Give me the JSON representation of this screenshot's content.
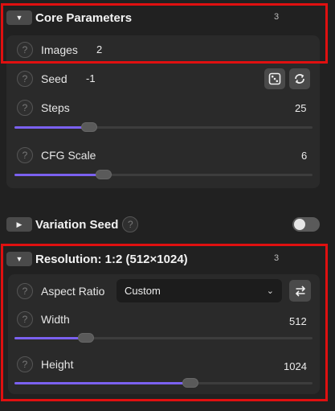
{
  "core": {
    "title": "Core Parameters",
    "count": "3",
    "images_label": "Images",
    "images_value": "2",
    "seed_label": "Seed",
    "seed_value": "-1",
    "steps_label": "Steps",
    "steps_value": "25",
    "steps_fraction": 0.25,
    "cfg_label": "CFG Scale",
    "cfg_value": "6",
    "cfg_fraction": 0.3
  },
  "variation": {
    "title": "Variation Seed",
    "enabled": false
  },
  "resolution": {
    "title": "Resolution: 1:2 (512×1024)",
    "count": "3",
    "aspect_label": "Aspect Ratio",
    "aspect_value": "Custom",
    "width_label": "Width",
    "width_value": "512",
    "width_fraction": 0.24,
    "height_label": "Height",
    "height_value": "1024",
    "height_fraction": 0.59
  },
  "help_glyph": "?",
  "icons": {
    "expanded": "chevron-down-icon",
    "collapsed": "chevron-right-icon",
    "dice": "dice-icon",
    "recycle": "recycle-icon",
    "swap": "swap-icon"
  },
  "colors": {
    "accent": "#7b61f0",
    "highlight": "#e01010",
    "background": "#212121",
    "panel": "#2a2a2a"
  }
}
